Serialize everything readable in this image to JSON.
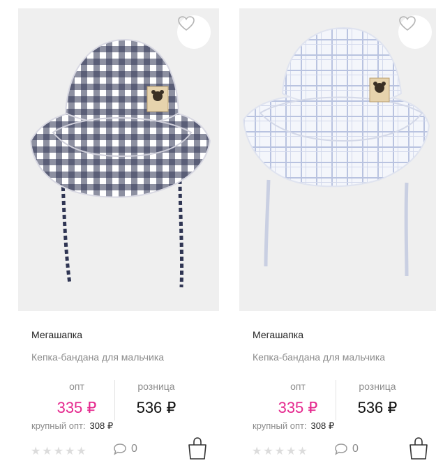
{
  "products": [
    {
      "brand": "Мегашапка",
      "title": "Кепка-бандана для мальчика",
      "opt_label": "опт",
      "opt_price": "335 ₽",
      "retail_label": "розница",
      "retail_price": "536 ₽",
      "bulk_label": "крупный опт:",
      "bulk_price": "308 ₽",
      "rating": 0,
      "comments": "0",
      "image": "navy-white gingham baby sun hat with ties and bear patch",
      "hat_color": "#2f3553"
    },
    {
      "brand": "Мегашапка",
      "title": "Кепка-бандана для мальчика",
      "opt_label": "опт",
      "opt_price": "335 ₽",
      "retail_label": "розница",
      "retail_price": "536 ₽",
      "bulk_label": "крупный опт:",
      "bulk_price": "308 ₽",
      "rating": 0,
      "comments": "0",
      "image": "light blue plaid baby sun hat with ties and bear patch",
      "hat_color": "#b9c3e0"
    }
  ],
  "icons": {
    "favorite": "heart-icon",
    "comments": "speech-bubble-icon",
    "cart": "shopping-bag-icon",
    "rating": "star-icon"
  },
  "colors": {
    "accent": "#e5298e",
    "card_bg": "#efefef"
  }
}
